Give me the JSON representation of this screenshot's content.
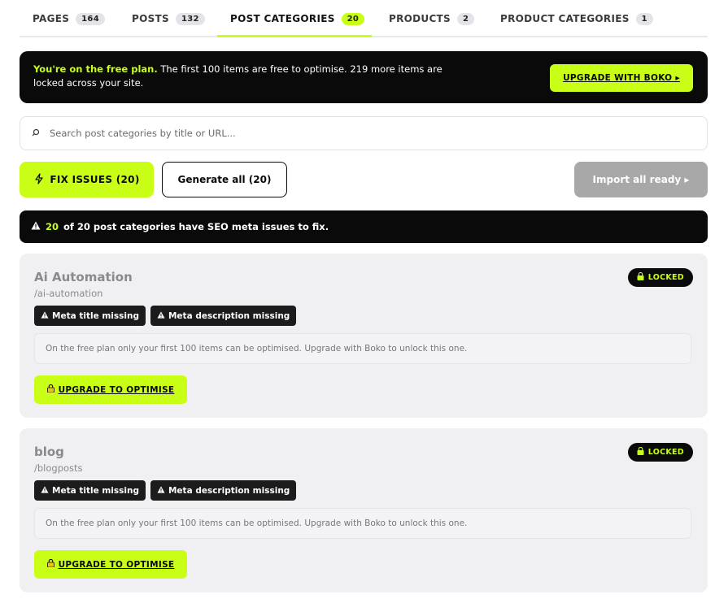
{
  "tabs": [
    {
      "label": "PAGES",
      "count": "164"
    },
    {
      "label": "POSTS",
      "count": "132"
    },
    {
      "label": "POST CATEGORIES",
      "count": "20"
    },
    {
      "label": "PRODUCTS",
      "count": "2"
    },
    {
      "label": "PRODUCT CATEGORIES",
      "count": "1"
    }
  ],
  "active_tab": "POST CATEGORIES",
  "banner": {
    "highlight": "You're on the free plan.",
    "text": " The first 100 items are free to optimise. 219 more items are locked across your site.",
    "button": "UPGRADE WITH BOKO ▸"
  },
  "search": {
    "placeholder": "Search post categories by title or URL...",
    "value": ""
  },
  "actions": {
    "fix": "FIX ISSUES (20)",
    "generate": "Generate all (20)",
    "import": "Import all ready ▸"
  },
  "issues_bar": {
    "count": "20",
    "text": "of 20 post categories have SEO meta issues to fix."
  },
  "cards": [
    {
      "title": "Ai Automation",
      "slug": "/ai-automation",
      "status": "LOCKED",
      "tags": [
        "Meta title missing",
        "Meta description missing"
      ],
      "note": "On the free plan only your first 100 items can be optimised. Upgrade with Boko to unlock this one.",
      "button": "UPGRADE TO OPTIMISE"
    },
    {
      "title": "blog",
      "slug": "/blogposts",
      "status": "LOCKED",
      "tags": [
        "Meta title missing",
        "Meta description missing"
      ],
      "note": "On the free plan only your first 100 items can be optimised. Upgrade with Boko to unlock this one.",
      "button": "UPGRADE TO OPTIMISE"
    }
  ],
  "colors": {
    "accent": "#c9ff16",
    "dark": "#0a0a0a",
    "card_bg": "#f0f0f3",
    "disabled": "#a8a8a8"
  },
  "icons": [
    "search-icon",
    "lightning-icon",
    "warning-icon",
    "lock-icon"
  ]
}
